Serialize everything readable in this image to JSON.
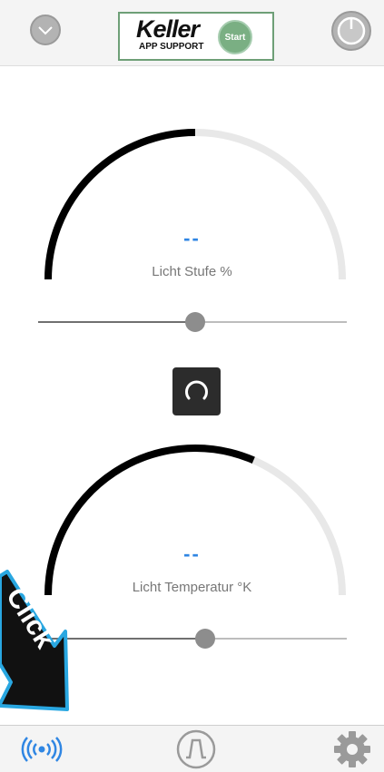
{
  "header": {
    "logo_title": "Keller",
    "logo_subtitle": "APP SUPPORT",
    "start_label": "Start"
  },
  "gauges": [
    {
      "value": "--",
      "label": "Licht Stufe %",
      "level": 0.5,
      "slider": 0.51
    },
    {
      "value": "--",
      "label": "Licht Temperatur °K",
      "level": 0.63,
      "slider": 0.54
    }
  ],
  "overlay": {
    "text": "Click"
  },
  "icons": {
    "top_left": "chevron-down-icon",
    "top_right": "power-icon",
    "reset": "refresh-icon",
    "nav_left": "broadcast-icon",
    "nav_center": "curve-icon",
    "nav_right": "gear-icon"
  },
  "colors": {
    "accent": "#2f86e3",
    "arc": "#000000",
    "track": "#e8e8e8",
    "logo_green": "#7aaf83"
  }
}
